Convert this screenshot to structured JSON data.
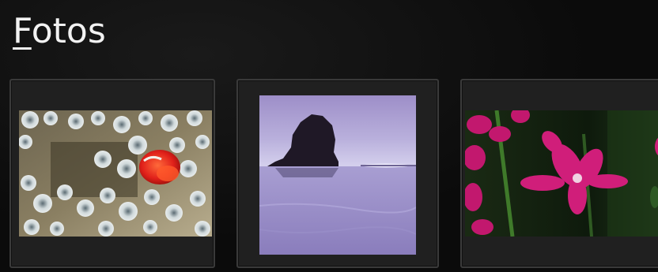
{
  "page": {
    "title_accel": "F",
    "title_rest": "otos"
  },
  "photos": [
    {
      "subject": "clownfish-in-anemone"
    },
    {
      "subject": "rock-island-at-dusk"
    },
    {
      "subject": "magenta-orchids"
    }
  ],
  "colors": {
    "background": "#0b0b0b",
    "tile": "#202020",
    "tile_border": "#3a3a3a",
    "title": "#f2f2f2"
  }
}
